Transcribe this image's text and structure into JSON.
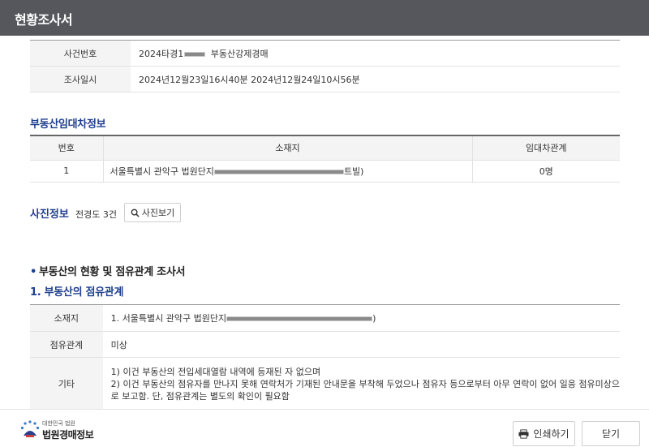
{
  "window": {
    "title": "현황조사서"
  },
  "case_info": {
    "rows": [
      {
        "label": "사건번호",
        "value_prefix": "2024타경1",
        "value_suffix": "부동산강제경매"
      },
      {
        "label": "조사일시",
        "value": "2024년12월23일16시40분 2024년12월24일10시56분"
      }
    ]
  },
  "lease": {
    "title": "부동산임대차정보",
    "headers": [
      "번호",
      "소재지",
      "임대차관계"
    ],
    "rows": [
      {
        "no": "1",
        "address_prefix": "서울특별시 관악구 법원단지",
        "address_suffix": "트빌)",
        "relation": "0명"
      }
    ]
  },
  "photo": {
    "label": "사진정보",
    "count": "전경도 3건",
    "button": "사진보기"
  },
  "report": {
    "title": "부동산의 현황 및 점유관계 조사서",
    "subtitle": "1. 부동산의 점유관계",
    "rows": [
      {
        "label": "소재지",
        "value_prefix": "1. 서울특별시 관악구 법원단지",
        "value_suffix": ")"
      },
      {
        "label": "점유관계",
        "value": "미상"
      },
      {
        "label": "기타",
        "lines": [
          "1) 이건 부동산의 전입세대열람 내역에 등재된 자 없으며",
          "2) 이건 부동산의 점유자를 만나지 못해 연락처가 기재된 안내문을 부착해 두었으나 점유자 등으로부터 아무 연락이 없어 일응 점유미상으",
          "로 보고함. 단, 점유관계는 별도의 확인이 필요함"
        ]
      }
    ]
  },
  "footer": {
    "logo_small": "대한민국 법원",
    "logo_big": "법원경매정보",
    "print_button": "인쇄하기",
    "close_button": "닫기"
  },
  "colors": {
    "titlebar": "#55575c",
    "accent": "#1f3f8f",
    "header_bg": "#f4f4f4"
  }
}
